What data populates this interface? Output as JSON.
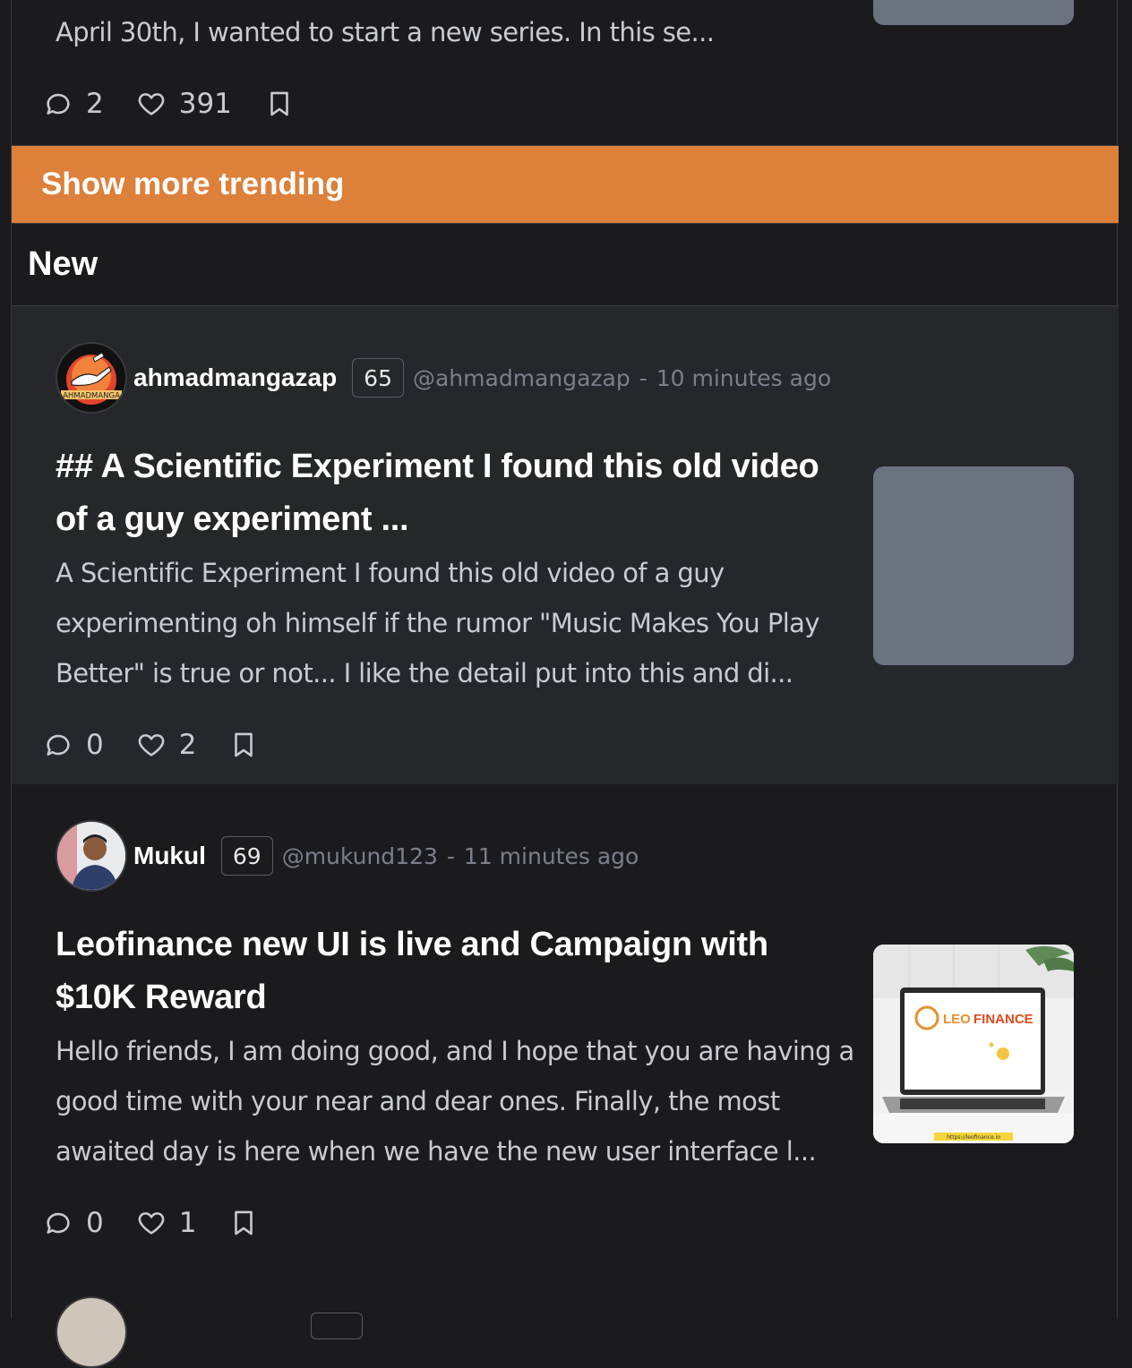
{
  "previous_post": {
    "excerpt_tail": "April 30th, I wanted to start a new series. In this se...",
    "comments": "2",
    "likes": "391"
  },
  "trending": {
    "show_more_label": "Show more trending"
  },
  "section": {
    "title": "New"
  },
  "posts": [
    {
      "author": "ahmadmangazap",
      "reputation": "65",
      "handle": "@ahmadmangazap",
      "separator": "-",
      "time": "10 minutes ago",
      "title_line1": "## A Scientific Experiment I found this old video",
      "title_line2": "of a guy experiment ...",
      "excerpt_line1": "A Scientific Experiment I found this old video of a guy",
      "excerpt_line2": "experimenting oh himself if the rumor \"Music Makes You Play",
      "excerpt_line3": "Better\" is true or not... I like the detail put into this and di...",
      "comments": "0",
      "likes": "2",
      "avatar_text": "AHMADMANGA"
    },
    {
      "author": "Mukul",
      "reputation": "69",
      "handle": "@mukund123",
      "separator": "-",
      "time": "11 minutes ago",
      "title_line1": "Leofinance new UI is live and Campaign with",
      "title_line2": "$10K Reward",
      "excerpt_line1": "Hello friends, I am doing good, and I hope that you are having a",
      "excerpt_line2": "good time with your near and dear ones. Finally, the most",
      "excerpt_line3": "awaited day is here when we have the new user interface l...",
      "comments": "0",
      "likes": "1",
      "thumb_brand_leo": "LEO",
      "thumb_brand_finance": "FINANCE",
      "thumb_url": "https://leofinance.io"
    }
  ],
  "icons": {
    "comment": "comment-icon",
    "like": "heart-icon",
    "bookmark": "bookmark-icon"
  },
  "colors": {
    "accent": "#dc803a",
    "background": "#1b1b1e",
    "highlight_row": "#26272b",
    "thumb_placeholder": "#6b7280"
  }
}
